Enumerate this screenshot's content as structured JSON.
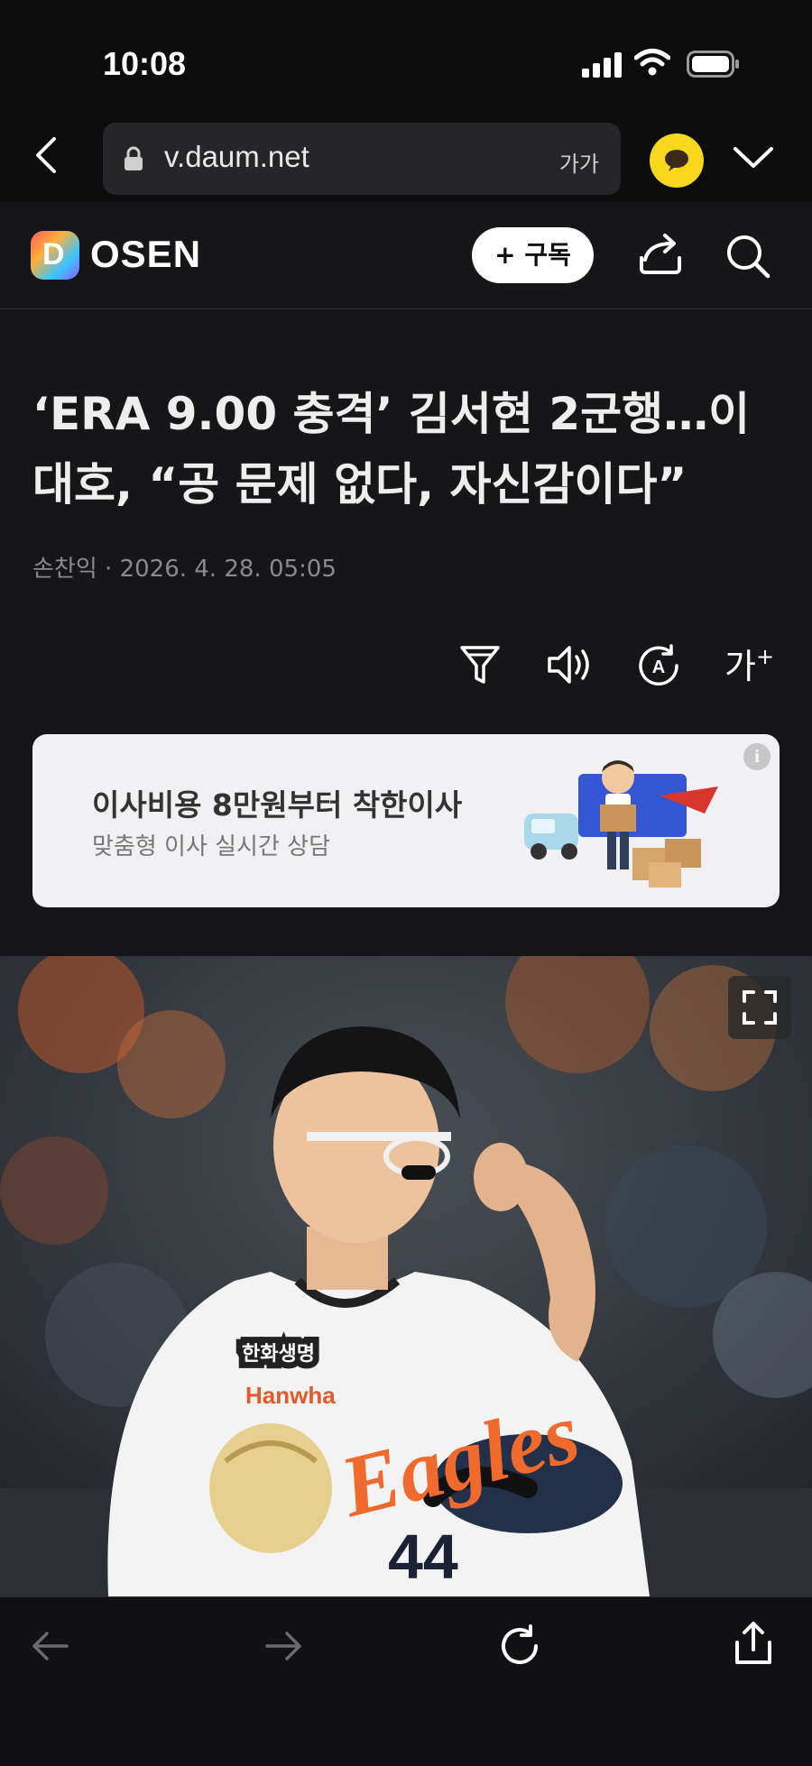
{
  "status_bar": {
    "time": "10:08"
  },
  "browser": {
    "url": "v.daum.net",
    "text_size_label": "가가"
  },
  "site": {
    "logo_letter": "D",
    "name": "OSEN",
    "subscribe_label": "+ 구독"
  },
  "article": {
    "headline": "‘ERA 9.00 충격’ 김서현 2군행…이대호, “공 문제 없다, 자신감이다”",
    "author": "손찬익",
    "separator": "·",
    "date": "2026. 4. 28. 05:05",
    "font_size_tool_label": "가"
  },
  "ad": {
    "title": "이사비용 8만원부터 착한이사",
    "subtitle": "맞춤형 이사 실시간 상담",
    "info_label": "i"
  },
  "photo": {
    "jersey_number": "44",
    "jersey_team": "Eagles",
    "sponsor_text": "Hanwha",
    "patch_text": "한화생명"
  },
  "icons": [
    "back-icon",
    "lock-icon",
    "kakao-talk-icon",
    "chevron-down-icon",
    "share-icon",
    "search-icon",
    "filter-icon",
    "speaker-icon",
    "translate-icon",
    "font-size-icon",
    "expand-icon",
    "forward-icon",
    "reload-icon",
    "share-upload-icon",
    "info-icon"
  ],
  "colors": {
    "background": "#161618",
    "kakao_yellow": "#f9d71c",
    "ad_background": "#f1f1f3"
  }
}
